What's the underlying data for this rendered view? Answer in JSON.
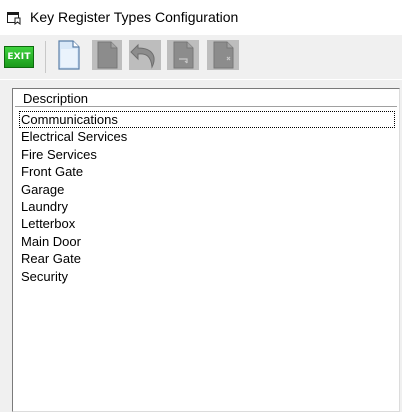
{
  "window": {
    "title": "Key Register Types Configuration",
    "icon": "form-window-icon"
  },
  "toolbar": {
    "exit_label": "EXIT",
    "buttons": [
      {
        "name": "new-record-button",
        "icon": "blank-document-icon",
        "enabled": true
      },
      {
        "name": "save-button",
        "icon": "save-document-icon",
        "enabled": false
      },
      {
        "name": "undo-button",
        "icon": "undo-arrow-icon",
        "enabled": false
      },
      {
        "name": "import-button",
        "icon": "document-import-icon",
        "enabled": false
      },
      {
        "name": "delete-button",
        "icon": "document-delete-icon",
        "enabled": false
      }
    ],
    "colors": {
      "exit_green": "#22b322",
      "new_doc_blue": "#cfe3f7",
      "disabled_gray": "#8c8c8c"
    }
  },
  "list": {
    "column_header": "Description",
    "rows": [
      "Communications",
      "Electrical Services",
      "Fire Services",
      "Front Gate",
      "Garage",
      "Laundry",
      "Letterbox",
      "Main Door",
      "Rear Gate",
      "Security"
    ],
    "focused_index": 0
  }
}
